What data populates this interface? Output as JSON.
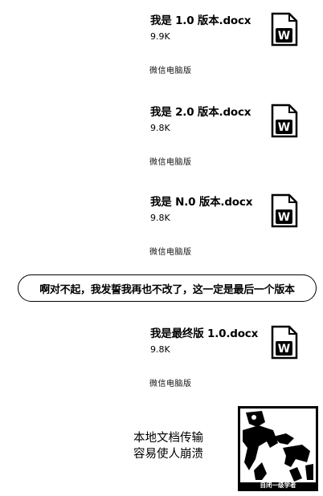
{
  "files": [
    {
      "name": "我是 1.0 版本.docx",
      "size": "9.9K",
      "source": "微信电脑版",
      "icon": "word-doc-icon"
    },
    {
      "name": "我是 2.0 版本.docx",
      "size": "9.8K",
      "source": "微信电脑版",
      "icon": "word-doc-icon"
    },
    {
      "name": "我是 N.0 版本.docx",
      "size": "9.8K",
      "source": "微信电脑版",
      "icon": "word-doc-icon"
    },
    {
      "name": "我是最终版 1.0.docx",
      "size": "9.8K",
      "source": "微信电脑版",
      "icon": "word-doc-icon"
    }
  ],
  "message": {
    "text": "啊对不起，我发誓我再也不改了，这一定是最后一个版本"
  },
  "caption": {
    "line1": "本地文档传输",
    "line2": "容易使人崩溃"
  },
  "meme": {
    "caption": "自闭一级学者"
  }
}
